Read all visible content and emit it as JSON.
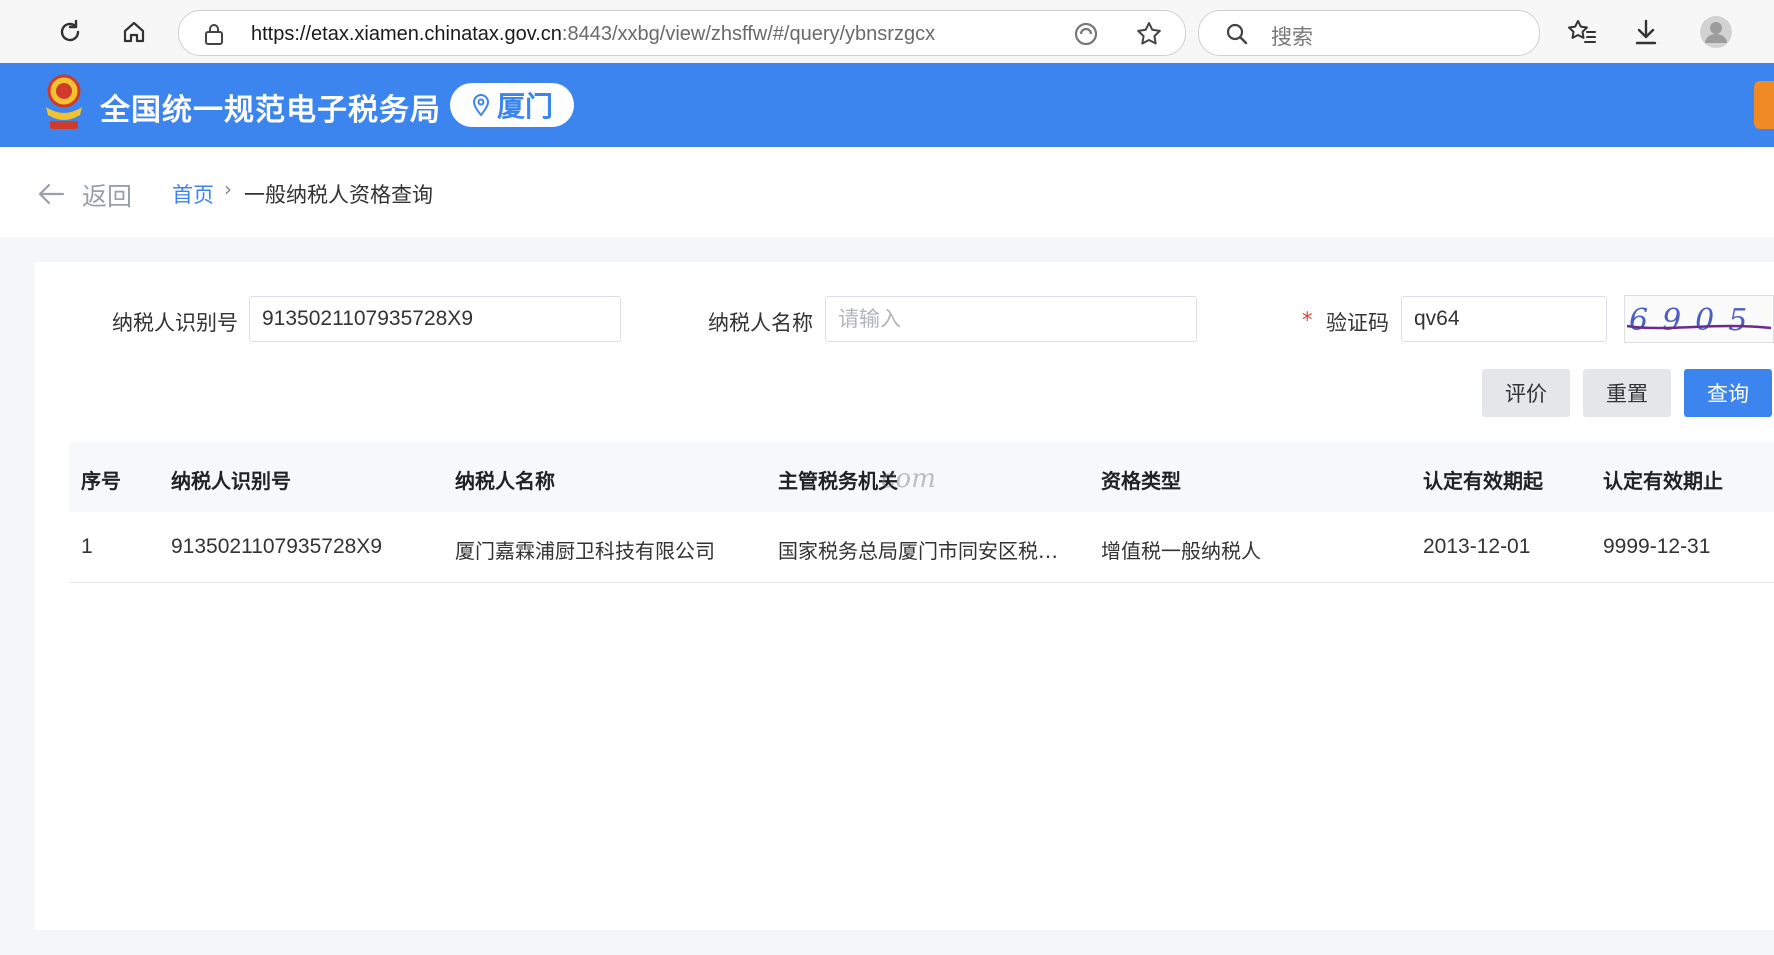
{
  "browser": {
    "url_host": "https://etax.xiamen.chinatax.gov.cn",
    "url_path": ":8443/xxbg/view/zhsffw/#/query/ybnsrzgcx",
    "search_placeholder": "搜索"
  },
  "header": {
    "site_title": "全国统一规范电子税务局",
    "city": "厦门"
  },
  "breadcrumb": {
    "back": "返回",
    "home": "首页",
    "separator": "›",
    "current": "一般纳税人资格查询"
  },
  "form": {
    "taxpayer_id_label": "纳税人识别号",
    "taxpayer_id_value": "9135021107935728X9",
    "taxpayer_name_label": "纳税人名称",
    "taxpayer_name_placeholder": "请输入",
    "captcha_required_mark": "*",
    "captcha_label": "验证码",
    "captcha_value": "qv64",
    "captcha_image_text": "6905"
  },
  "buttons": {
    "evaluate": "评价",
    "reset": "重置",
    "query": "查询"
  },
  "table": {
    "headers": [
      "序号",
      "纳税人识别号",
      "纳税人名称",
      "主管税务机关",
      "资格类型",
      "认定有效期起",
      "认定有效期止"
    ],
    "rows": [
      [
        "1",
        "9135021107935728X9",
        "厦门嘉霖浦厨卫科技有限公司",
        "国家税务总局厦门市同安区税…",
        "增值税一般纳税人",
        "2013-12-01",
        "9999-12-31"
      ]
    ],
    "watermark": "com"
  },
  "colors": {
    "brand_blue": "#3d85ee",
    "required_red": "#e0463a",
    "accent_orange": "#f08a24"
  }
}
